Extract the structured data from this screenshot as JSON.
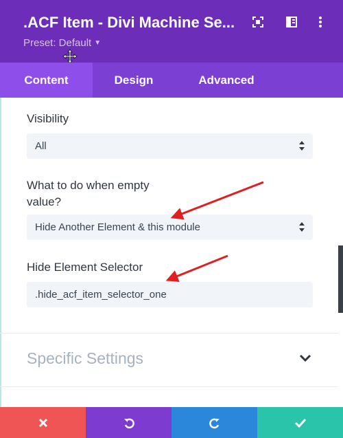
{
  "header": {
    "title": ".ACF Item - Divi Machine Se...",
    "preset": "Preset: Default",
    "bg_color": "#6c2eb9"
  },
  "tabs": [
    {
      "label": "Content",
      "active": true
    },
    {
      "label": "Design",
      "active": false
    },
    {
      "label": "Advanced",
      "active": false
    }
  ],
  "fields": {
    "visibility": {
      "label": "Visibility",
      "value": "All"
    },
    "empty_value": {
      "label": "What to do when empty value?",
      "value": "Hide Another Element & this module"
    },
    "hide_selector": {
      "label": "Hide Element Selector",
      "value": ".hide_acf_item_selector_one"
    }
  },
  "sections": {
    "specific_settings": "Specific Settings"
  },
  "footer": {
    "buttons": [
      {
        "name": "cancel",
        "color": "#ef5555",
        "icon": "close-icon"
      },
      {
        "name": "undo",
        "color": "#7e3bd0",
        "icon": "undo-icon"
      },
      {
        "name": "redo",
        "color": "#2b87da",
        "icon": "redo-icon"
      },
      {
        "name": "save",
        "color": "#29c4a9",
        "icon": "check-icon"
      }
    ]
  }
}
